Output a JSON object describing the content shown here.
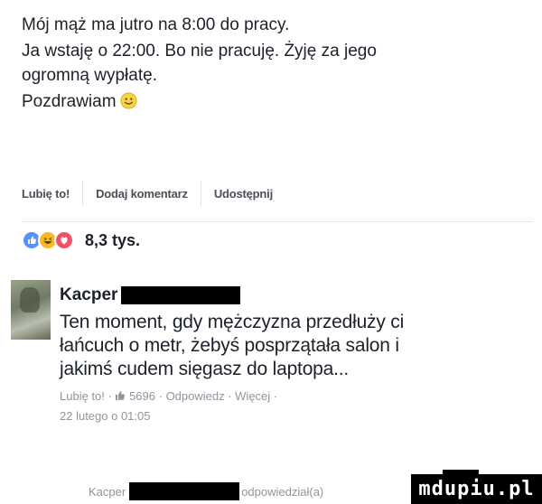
{
  "post": {
    "line1": "Mój mąż ma jutro na 8:00 do pracy.",
    "line2": "Ja wstaję o 22:00. Bo nie pracuję. Żyję za jego",
    "line3": "ogromną wypłatę.",
    "line4": "Pozdrawiam",
    "emoji_icon": "smile-emoji-icon"
  },
  "actions": {
    "like": "Lubię to!",
    "comment": "Dodaj komentarz",
    "share": "Udostępnij"
  },
  "reactions": {
    "icons": [
      "like-reaction-icon",
      "haha-reaction-icon",
      "love-reaction-icon"
    ],
    "count": "8,3 tys."
  },
  "comment": {
    "author": "Kacper",
    "text_line1": "Ten moment, gdy mężczyzna przedłuży ci",
    "text_line2": "łańcuch o metr, żebyś posprzątała salon i",
    "text_line3": "jakimś cudem sięgasz do laptopa...",
    "meta_like": "Lubię to! ·",
    "meta_likes_count": "5696",
    "meta_reply": "· Odpowiedz · Więcej ·",
    "date": "22 lutego o 01:05"
  },
  "reply": {
    "author": "Kacper",
    "action": "odpowiedział(a)"
  },
  "watermark": "mdupiu.pl",
  "colors": {
    "text": "#1d2129",
    "muted": "#90949c",
    "like_blue": "#5890ff",
    "haha_yellow": "#f7b928",
    "love_red": "#f25268"
  }
}
